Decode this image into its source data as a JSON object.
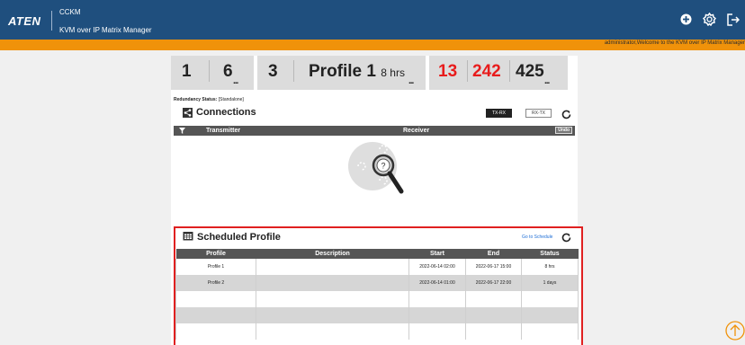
{
  "header": {
    "logo": "ATEN",
    "app_short": "CCKM",
    "app_long": "KVM over IP Matrix Manager",
    "icons": [
      "add-icon",
      "settings-gear-icon",
      "logout-icon"
    ]
  },
  "welcome": "administrator,Welcome to the KVM over IP Matrix Manager",
  "summary": {
    "a": "1",
    "b": "6",
    "c": "3",
    "profile_name": "Profile 1",
    "profile_duration": "8 hrs",
    "n1": "13",
    "n2": "242",
    "n3": "425",
    "dots": "...",
    "alert_color": "#e81c1c"
  },
  "redundancy": {
    "label": "Redundancy Status:",
    "value": "[Standalone]"
  },
  "connections": {
    "title": "Connections",
    "btn_txrx": "TX-RX",
    "btn_rxtx": "RX-TX",
    "col_transmitter": "Transmitter",
    "col_receiver": "Receiver",
    "undo": "Undo"
  },
  "schedule": {
    "title": "Scheduled Profile",
    "goto": "Go to Schedule",
    "columns": [
      "Profile",
      "Description",
      "Start",
      "End",
      "Status"
    ],
    "rows": [
      [
        "Profile 1",
        "",
        "2022-06-14 02:00",
        "2022-06-17 15:00",
        "8 hrs"
      ],
      [
        "Profile 2",
        "",
        "2022-06-14 01:00",
        "2022-06-17 22:00",
        "1 days"
      ],
      [
        "",
        "",
        "",
        "",
        ""
      ],
      [
        "",
        "",
        "",
        "",
        ""
      ],
      [
        "",
        "",
        "",
        "",
        ""
      ]
    ]
  }
}
